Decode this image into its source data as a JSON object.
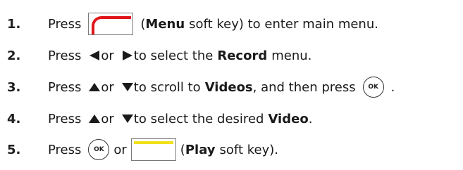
{
  "steps": [
    {
      "number": "1.",
      "press": "Press",
      "paren_open": "(",
      "key_name": "Menu",
      "after_key": "soft key) to enter main menu."
    },
    {
      "number": "2.",
      "press": "Press",
      "or": "or",
      "to_select": "to select the",
      "item": "Record",
      "tail": "menu."
    },
    {
      "number": "3.",
      "press": "Press",
      "or": "or",
      "to_scroll": "to scroll to",
      "item": "Videos",
      "tail": ", and then press",
      "ok_label": "OK",
      "end": "."
    },
    {
      "number": "4.",
      "press": "Press",
      "or": "or",
      "to_select": "to select the desired",
      "item": "Video",
      "end": "."
    },
    {
      "number": "5.",
      "press": "Press",
      "ok_label": "OK",
      "or": "or",
      "paren_open": "(",
      "key_name": "Play",
      "after_key": "soft key)."
    }
  ],
  "colors": {
    "menu_softkey": "#e0151b",
    "play_softkey": "#f0e11a",
    "arrow": "#1a1a1a"
  },
  "icons": {
    "left": "left-arrow-icon",
    "right": "right-arrow-icon",
    "up": "up-arrow-icon",
    "down": "down-arrow-icon",
    "ok": "ok-key-icon",
    "menu_softkey": "red-softkey-icon",
    "play_softkey": "yellow-softkey-icon"
  }
}
